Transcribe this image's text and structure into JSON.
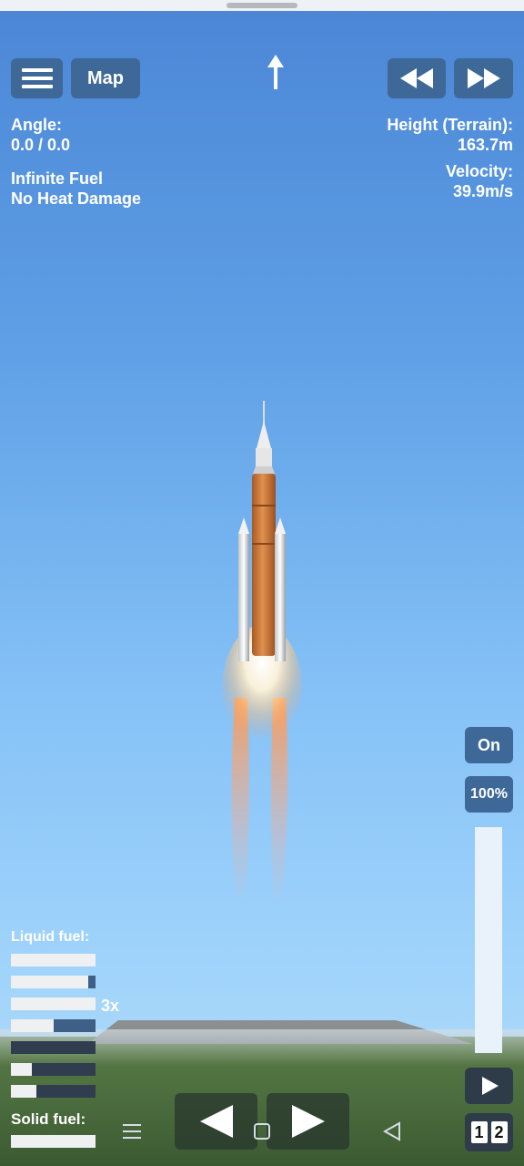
{
  "hud": {
    "menu_icon": "hamburger-icon",
    "map_label": "Map",
    "angle_label": "Angle:",
    "angle_value": "0.0 / 0.0",
    "cheat_fuel": "Infinite Fuel",
    "cheat_heat": "No Heat Damage",
    "height_label": "Height (Terrain):",
    "height_value": "163.7m",
    "velocity_label": "Velocity:",
    "velocity_value": "39.9m/s"
  },
  "time_controls": {
    "slow_icon": "rewind-icon",
    "fast_icon": "fast-forward-icon"
  },
  "fuel": {
    "liquid_label": "Liquid fuel:",
    "solid_label": "Solid fuel:",
    "multiplier_label": "3x",
    "liquid_bars": [
      1.0,
      0.91,
      1.0,
      0.5,
      0.0,
      0.25,
      0.3
    ],
    "solid_bars": [
      1.0
    ]
  },
  "right_panel": {
    "sas_label": "On",
    "throttle_label": "100%",
    "throttle_level": 1.0,
    "stage_digits": [
      "1",
      "2"
    ]
  },
  "controls": {
    "left_icon": "rotate-left-icon",
    "right_icon": "rotate-right-icon",
    "play_icon": "play-icon"
  },
  "colors": {
    "button_bg": "#3e6897",
    "rocket_core": "#c8763a",
    "sky_top": "#4b86d6",
    "sky_bottom": "#b5def9"
  }
}
